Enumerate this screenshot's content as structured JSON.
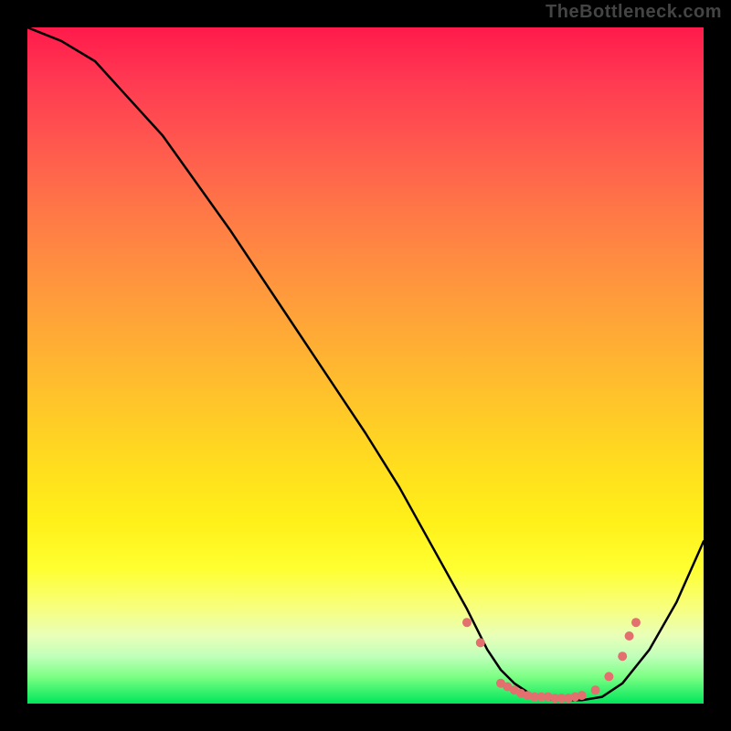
{
  "watermark": "TheBottleneck.com",
  "chart_data": {
    "type": "line",
    "title": "",
    "xlabel": "",
    "ylabel": "",
    "xlim": [
      0,
      100
    ],
    "ylim": [
      0,
      100
    ],
    "grid": false,
    "legend": false,
    "background_gradient": [
      "#ff1a4b",
      "#ff7a46",
      "#ffde1e",
      "#ffff30",
      "#00e65a"
    ],
    "series": [
      {
        "name": "curve",
        "x": [
          0,
          5,
          10,
          20,
          30,
          40,
          50,
          55,
          60,
          65,
          68,
          70,
          72,
          75,
          78,
          80,
          82,
          85,
          88,
          92,
          96,
          100
        ],
        "y": [
          100,
          98,
          95,
          84,
          70,
          55,
          40,
          32,
          23,
          14,
          8,
          5,
          3,
          1,
          0.5,
          0.5,
          0.5,
          1,
          3,
          8,
          15,
          24
        ],
        "color": "#000000",
        "marker": "none"
      },
      {
        "name": "flat-bottom-markers",
        "x": [
          65,
          67,
          70,
          71,
          72,
          73,
          74,
          75,
          76,
          77,
          78,
          79,
          80,
          81,
          82,
          84,
          86,
          88,
          89,
          90
        ],
        "y": [
          12,
          9,
          3,
          2.5,
          2,
          1.5,
          1.2,
          1,
          1,
          1,
          0.8,
          0.8,
          0.8,
          1,
          1.2,
          2,
          4,
          7,
          10,
          12
        ],
        "color": "#e36f6f",
        "marker": "circle"
      }
    ]
  }
}
